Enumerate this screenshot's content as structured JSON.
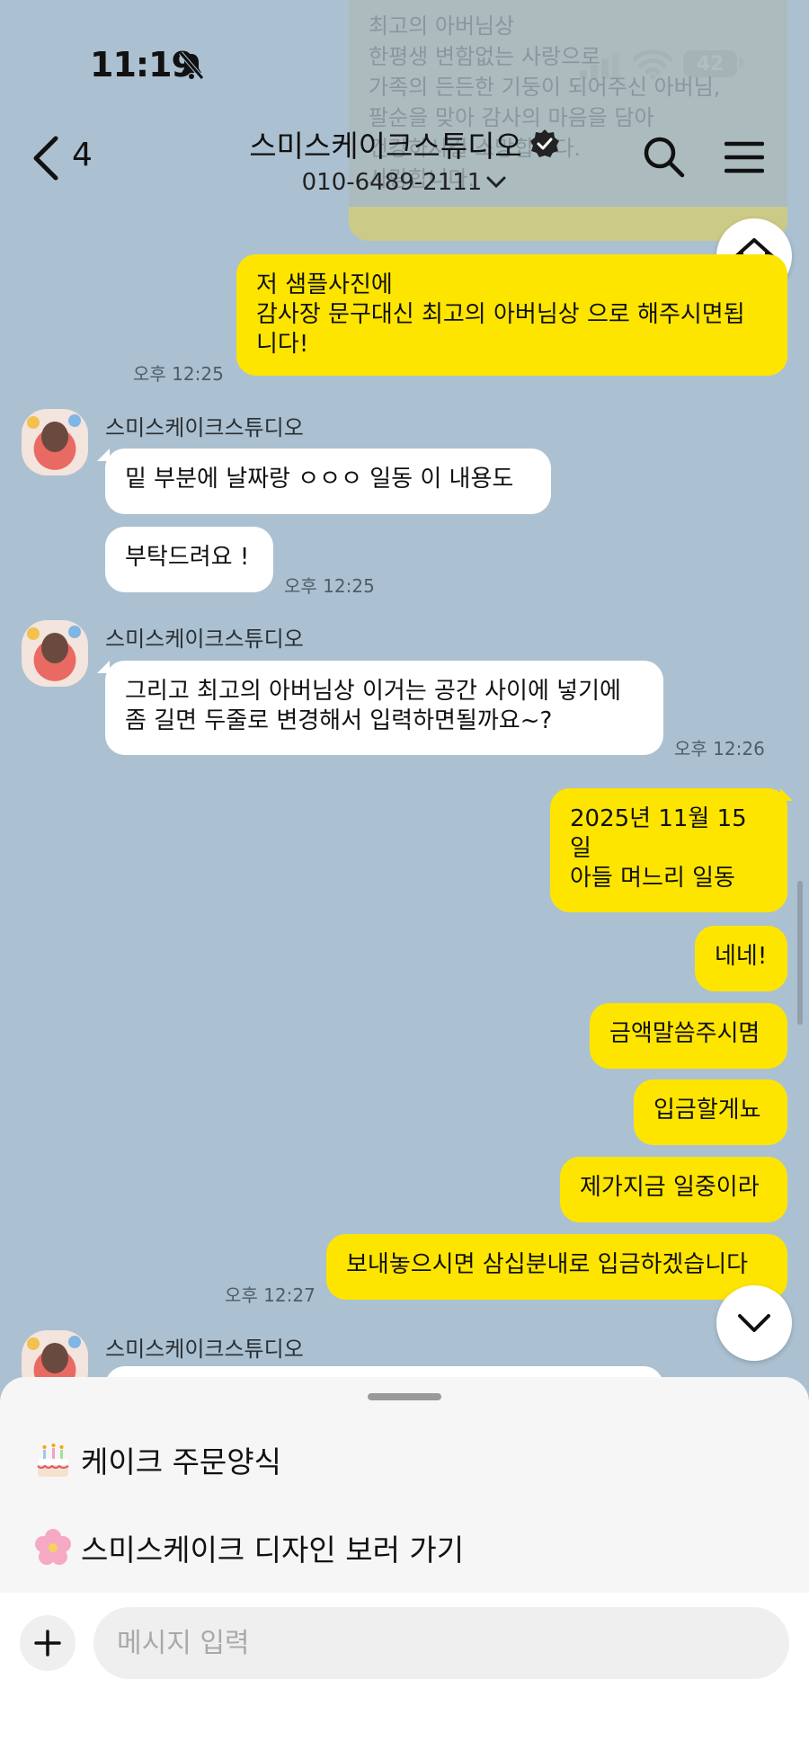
{
  "status": {
    "time": "11:19",
    "battery": "42"
  },
  "header": {
    "back_count": "4",
    "title": "스미스케이크스튜디오",
    "phone": "010-6489-2111"
  },
  "notice": {
    "text": "최고의 아버님상\n한평생 변함없는 사랑으로\n가족의 든든한 기둥이 되어주신 아버님,\n팔순을 맞아 감사의 마음을 담아\n건강하시길 소망합니다.\n사랑합니다."
  },
  "messages": [
    {
      "side": "me",
      "text": "저 샘플사진에\n감사장 문구대신 최고의 아버님상 으로 해주시면됩\n니다!",
      "time": "오후 12:25"
    },
    {
      "side": "them",
      "sender": "스미스케이크스튜디오",
      "text": "밑 부분에 날짜랑 ㅇㅇㅇ 일동 이 내용도"
    },
    {
      "side": "them",
      "text": "부탁드려요 !",
      "time": "오후 12:25"
    },
    {
      "side": "them",
      "sender": "스미스케이크스튜디오",
      "text": "그리고 최고의 아버님상 이거는 공간 사이에 넣기에\n좀 길면 두줄로 변경해서 입력하면될까요~?",
      "time": "오후 12:26"
    },
    {
      "side": "me",
      "text": "2025년 11월 15일\n아들 며느리 일동"
    },
    {
      "side": "me",
      "text": "네네!"
    },
    {
      "side": "me",
      "text": "금액말씀주시몀"
    },
    {
      "side": "me",
      "text": "입금할게뇨"
    },
    {
      "side": "me",
      "text": "제가지금 일중이라"
    },
    {
      "side": "me",
      "text": "보내놓으시면 삼십분내로 입금하겠습니다",
      "time": "오후 12:27"
    },
    {
      "side": "them",
      "sender": "스미스케이크스튜디오",
      "text": ""
    }
  ],
  "quick_menu": [
    {
      "icon": "cake-emoji-icon",
      "label": "케이크 주문양식"
    },
    {
      "icon": "blossom-emoji-icon",
      "label": "스미스케이크 디자인 보러 가기"
    }
  ],
  "composer": {
    "placeholder": "메시지 입력"
  }
}
